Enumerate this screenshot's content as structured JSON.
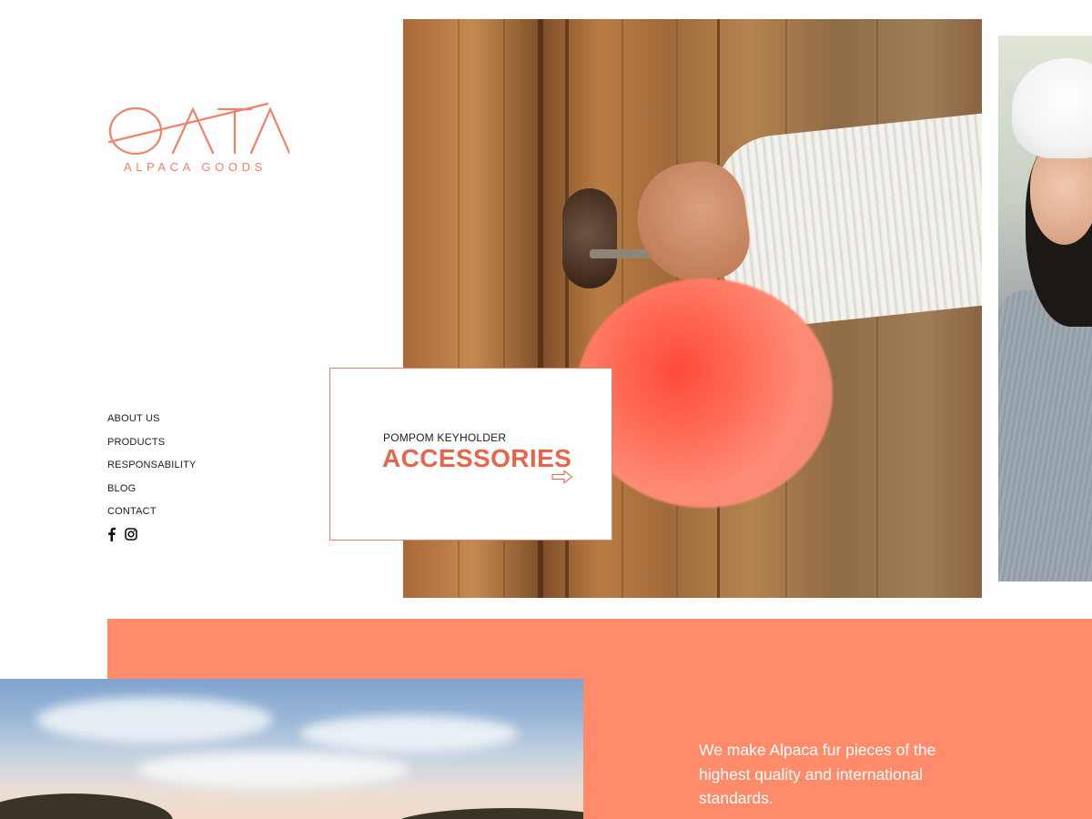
{
  "brand": {
    "logo_text": "OATA",
    "subtitle": "ALPACA GOODS",
    "accent_color": "#f0826a"
  },
  "nav": {
    "items": [
      {
        "label": "ABOUT US"
      },
      {
        "label": "PRODUCTS"
      },
      {
        "label": "RESPONSABILITY"
      },
      {
        "label": "BLOG"
      },
      {
        "label": "CONTACT"
      }
    ]
  },
  "social": {
    "icons": [
      "facebook-icon",
      "instagram-icon"
    ]
  },
  "hero_card": {
    "kicker": "POMPOM KEYHOLDER",
    "title": "ACCESSORIES",
    "title_color": "#e8654a",
    "arrow_icon": "arrow-right-icon"
  },
  "promo": {
    "band_color": "#ff8b6b",
    "tagline": "We make Alpaca fur pieces of the highest quality and international standards."
  }
}
